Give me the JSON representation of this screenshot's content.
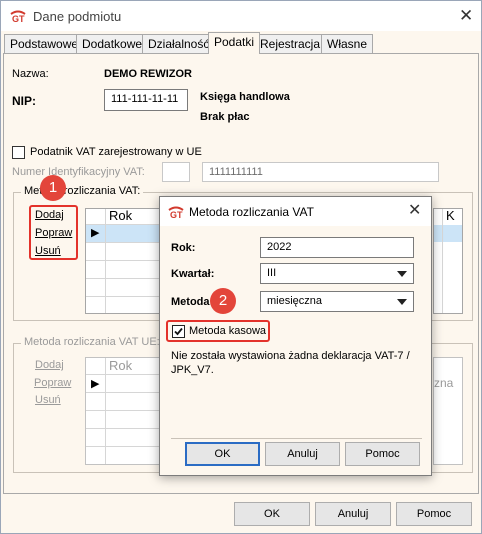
{
  "window": {
    "title": "Dane podmiotu",
    "tabs": [
      "Podstawowe",
      "Dodatkowe",
      "Działalność",
      "Podatki",
      "Rejestracja",
      "Własne"
    ],
    "active_tab": "Podatki"
  },
  "form": {
    "name_label": "Nazwa:",
    "name_value": "DEMO REWIZOR",
    "nip_label": "NIP:",
    "nip_value": "111-111-11-11",
    "ledger_type": "Księga handlowa",
    "payroll": "Brak płac",
    "vat_ue_checkbox_label": "Podatnik VAT zarejestrowany w UE",
    "vat_id_label": "Numer Identyfikacyjny VAT:",
    "vat_id_value": "1111111111"
  },
  "group_vat": {
    "title": "Metoda rozliczania VAT:",
    "add": "Dodaj",
    "edit": "Popraw",
    "delete": "Usuń",
    "col_year": "Rok",
    "col_k": "K"
  },
  "group_vat_ue": {
    "title": "Metoda rozliczania VAT UE:",
    "add": "Dodaj",
    "edit": "Popraw",
    "delete": "Usuń",
    "col_year": "Rok",
    "col_tail": "zna"
  },
  "main_buttons": {
    "ok": "OK",
    "cancel": "Anuluj",
    "help": "Pomoc"
  },
  "dialog": {
    "title": "Metoda rozliczania VAT",
    "year_label": "Rok:",
    "year_value": "2022",
    "quarter_label": "Kwartał:",
    "quarter_value": "III",
    "method_label": "Metoda:",
    "method_value": "miesięczna",
    "cash_method_label": "Metoda kasowa",
    "cash_method_checked": true,
    "info_text": "Nie została wystawiona żadna deklaracja VAT-7 / JPK_V7.",
    "ok": "OK",
    "cancel": "Anuluj",
    "help": "Pomoc"
  },
  "badges": {
    "first": "1",
    "second": "2"
  },
  "colors": {
    "highlight_red": "#e3322b",
    "badge_red": "#e3453a",
    "selected_row": "#cce4f7",
    "default_button_border": "#2b6cc4"
  }
}
